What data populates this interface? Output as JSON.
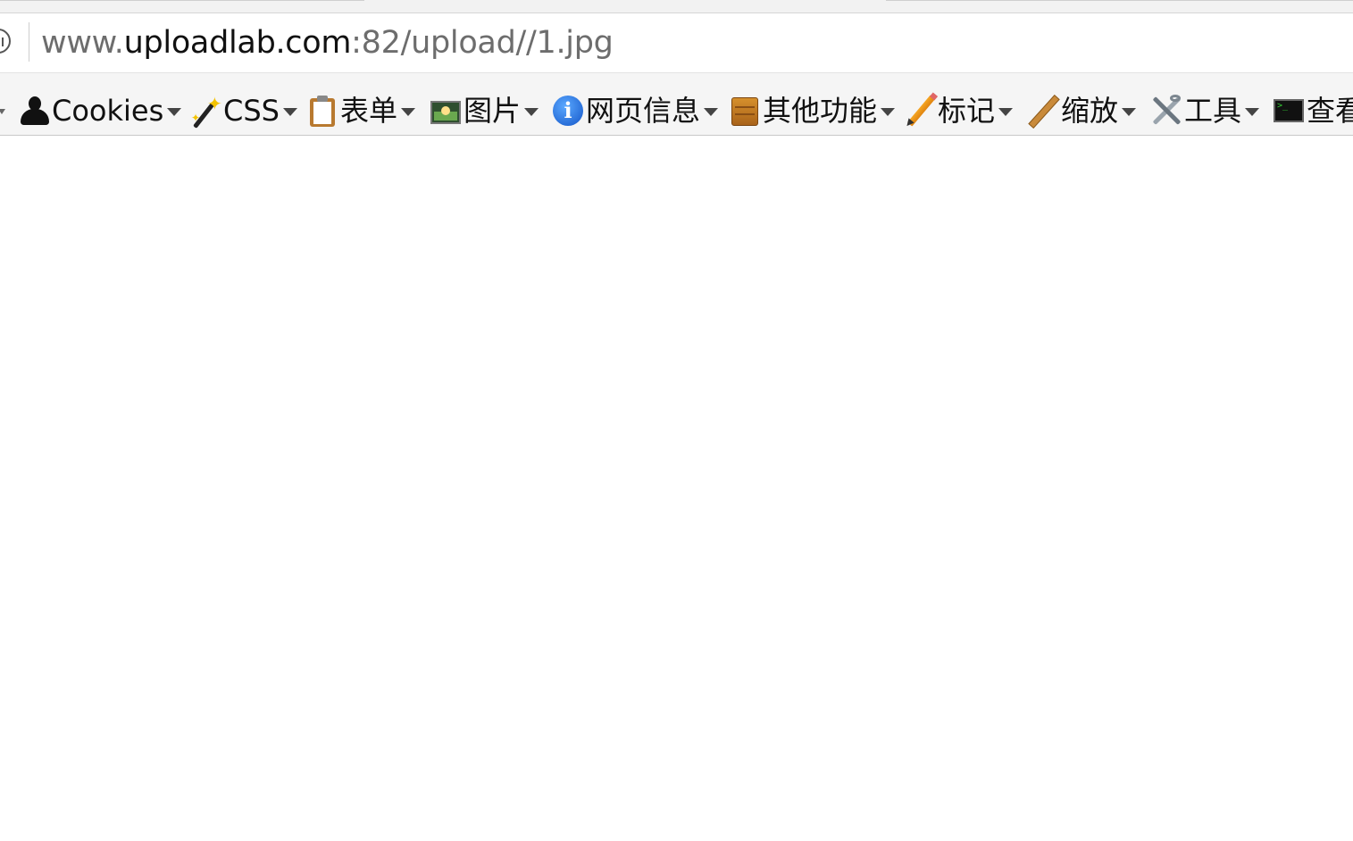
{
  "browser": {
    "url": {
      "prefix": "www.",
      "domain": "uploadlab.com",
      "suffix": ":82/upload//1.jpg"
    }
  },
  "toolbar": {
    "items": [
      {
        "label": "Cookies",
        "icon": "user-icon"
      },
      {
        "label": "CSS",
        "icon": "magic-wand-icon"
      },
      {
        "label": "表单",
        "icon": "clipboard-icon"
      },
      {
        "label": "图片",
        "icon": "image-icon"
      },
      {
        "label": "网页信息",
        "icon": "info-icon"
      },
      {
        "label": "其他功能",
        "icon": "box-icon"
      },
      {
        "label": "标记",
        "icon": "pencil-icon"
      },
      {
        "label": "缩放",
        "icon": "ruler-icon"
      },
      {
        "label": "工具",
        "icon": "tools-icon"
      },
      {
        "label": "查看",
        "icon": "terminal-icon"
      }
    ]
  },
  "colors": {
    "toolbar_bg": "#f5f5f5",
    "url_domain": "#111111",
    "url_rest": "#6d6d6d",
    "info_blue": "#1456c8"
  }
}
